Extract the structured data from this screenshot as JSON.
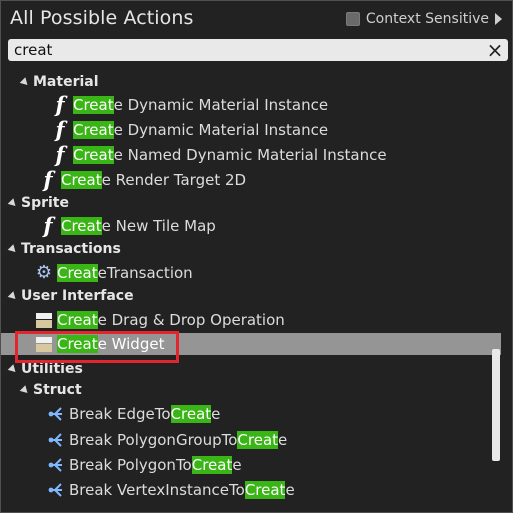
{
  "header": {
    "title": "All Possible Actions",
    "context_label": "Context Sensitive"
  },
  "search": {
    "value": "creat"
  },
  "icons": {
    "function": "f",
    "close": "×",
    "gear": "⚙"
  },
  "highlight_color": "#3ab516",
  "rows": [
    {
      "kind": "cat",
      "label": "Material"
    },
    {
      "kind": "item",
      "icon": "function",
      "pre": "",
      "hl": "Creat",
      "post": "e Dynamic Material Instance"
    },
    {
      "kind": "item",
      "icon": "function",
      "pre": "",
      "hl": "Creat",
      "post": "e Dynamic Material Instance"
    },
    {
      "kind": "item",
      "icon": "function",
      "pre": "",
      "hl": "Creat",
      "post": "e Named Dynamic Material Instance"
    },
    {
      "kind": "item",
      "icon": "function",
      "pre": "",
      "hl": "Creat",
      "post": "e Render Target 2D"
    },
    {
      "kind": "cat",
      "label": "Sprite"
    },
    {
      "kind": "item",
      "icon": "function",
      "pre": "",
      "hl": "Creat",
      "post": "e New Tile Map"
    },
    {
      "kind": "cat",
      "label": "Transactions"
    },
    {
      "kind": "item",
      "icon": "gear",
      "pre": "",
      "hl": "Creat",
      "post": "eTransaction"
    },
    {
      "kind": "cat",
      "label": "User Interface"
    },
    {
      "kind": "item",
      "icon": "widget",
      "pre": "",
      "hl": "Creat",
      "post": "e Drag & Drop Operation"
    },
    {
      "kind": "item",
      "icon": "widget",
      "pre": "",
      "hl": "Creat",
      "post": "e Widget",
      "selected": true
    },
    {
      "kind": "cat",
      "label": "Utilities"
    },
    {
      "kind": "cat",
      "label": "Struct"
    },
    {
      "kind": "item",
      "icon": "break",
      "pre": "Break EdgeTo",
      "hl": "Creat",
      "post": "e"
    },
    {
      "kind": "item",
      "icon": "break",
      "pre": "Break PolygonGroupTo",
      "hl": "Creat",
      "post": "e"
    },
    {
      "kind": "item",
      "icon": "break",
      "pre": "Break PolygonTo",
      "hl": "Creat",
      "post": "e"
    },
    {
      "kind": "item",
      "icon": "break",
      "pre": "Break VertexInstanceTo",
      "hl": "Creat",
      "post": "e"
    }
  ]
}
